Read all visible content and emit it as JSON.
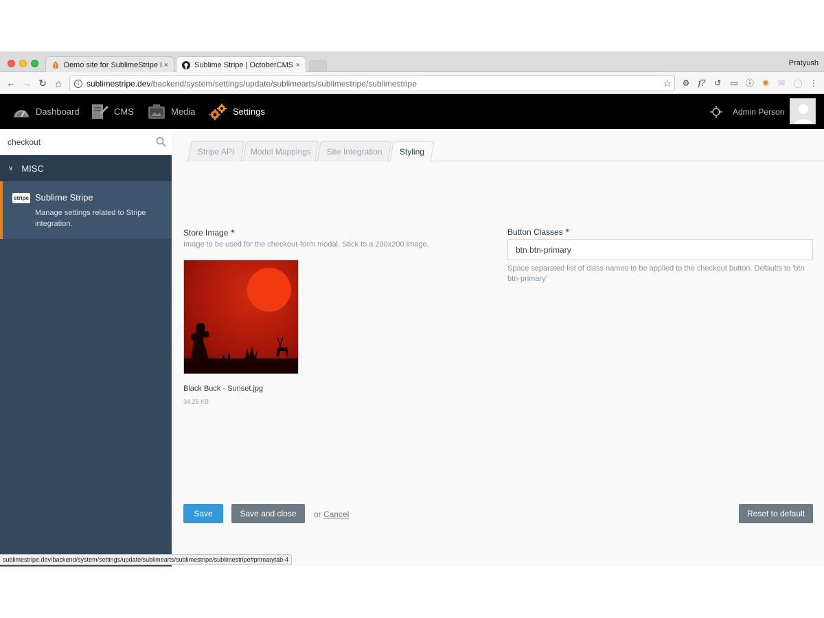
{
  "browser": {
    "tabs": [
      {
        "title": "Demo site for SublimeStripe Pl",
        "close": "×"
      },
      {
        "title": "Sublime Stripe | OctoberCMS",
        "close": "×"
      }
    ],
    "profile": "Pratyush",
    "url_host": "sublimestripe.dev",
    "url_path": "/backend/system/settings/update/sublimearts/sublimestripe/sublimestripe",
    "status_url": "sublimestripe.dev/backend/system/settings/update/sublimearts/sublimestripe/sublimestripe#primarytab-4"
  },
  "nav": {
    "items": [
      {
        "label": "Dashboard",
        "icon": "speedometer-icon"
      },
      {
        "label": "CMS",
        "icon": "cms-icon"
      },
      {
        "label": "Media",
        "icon": "media-icon"
      },
      {
        "label": "Settings",
        "icon": "gears-icon"
      }
    ],
    "admin_name": "Admin Person"
  },
  "sidebar": {
    "search_value": "checkout",
    "group": "MISC",
    "item": {
      "logo": "stripe",
      "title": "Sublime Stripe",
      "description": "Manage settings related to Stripe integration."
    }
  },
  "form": {
    "tabs": [
      "Stripe API",
      "Model Mappings",
      "Site Integration",
      "Styling"
    ],
    "active_tab": "Styling",
    "store_image": {
      "label": "Store Image",
      "required_mark": "•",
      "help": "Image to be used for the checkout-form modal. Stick to a 200x200 image.",
      "file_name": "Black Buck - Sunset.jpg",
      "file_size": "34.25 KB"
    },
    "button_classes": {
      "label": "Button Classes",
      "required_mark": "•",
      "value": "btn btn-primary",
      "help": "Space separated list of class names to be applied to the checkout button. Defaults to 'btn btn-primary'"
    }
  },
  "actions": {
    "save": "Save",
    "save_close": "Save and close",
    "or": "or",
    "cancel": "Cancel",
    "reset": "Reset to default"
  },
  "colors": {
    "accent": "#e67e22",
    "primary_button": "#3498db",
    "sidebar": "#34495e"
  }
}
